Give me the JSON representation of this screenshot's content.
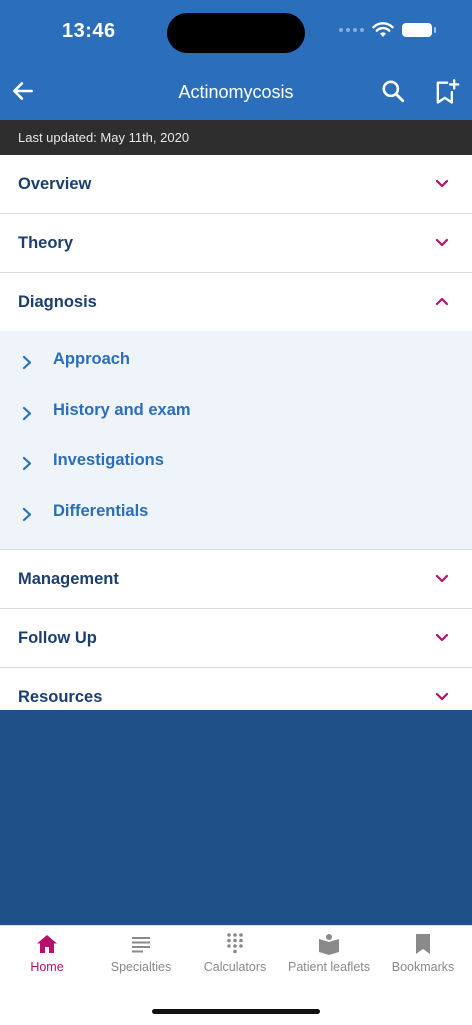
{
  "status": {
    "time": "13:46"
  },
  "app_bar": {
    "title": "Actinomycosis"
  },
  "updated": "Last updated: May 11th, 2020",
  "sections": [
    {
      "label": "Overview"
    },
    {
      "label": "Theory"
    },
    {
      "label": "Diagnosis",
      "expanded": true,
      "items": [
        {
          "label": "Approach"
        },
        {
          "label": "History and exam"
        },
        {
          "label": "Investigations"
        },
        {
          "label": "Differentials"
        }
      ]
    },
    {
      "label": "Management"
    },
    {
      "label": "Follow Up"
    },
    {
      "label": "Resources"
    }
  ],
  "tabs": [
    {
      "label": "Home",
      "icon": "home-icon",
      "active": true
    },
    {
      "label": "Specialties",
      "icon": "list-icon"
    },
    {
      "label": "Calculators",
      "icon": "keypad-icon"
    },
    {
      "label": "Patient leaflets",
      "icon": "book-icon"
    },
    {
      "label": "Bookmarks",
      "icon": "bookmark-icon"
    }
  ],
  "colors": {
    "header_blue": "#2a6ebc",
    "section_text": "#1d3f6e",
    "sub_text": "#2a6ebc",
    "chevron_magenta": "#b5116a",
    "updated_bar": "#2e2e2e",
    "content_fill": "#1f5088"
  }
}
